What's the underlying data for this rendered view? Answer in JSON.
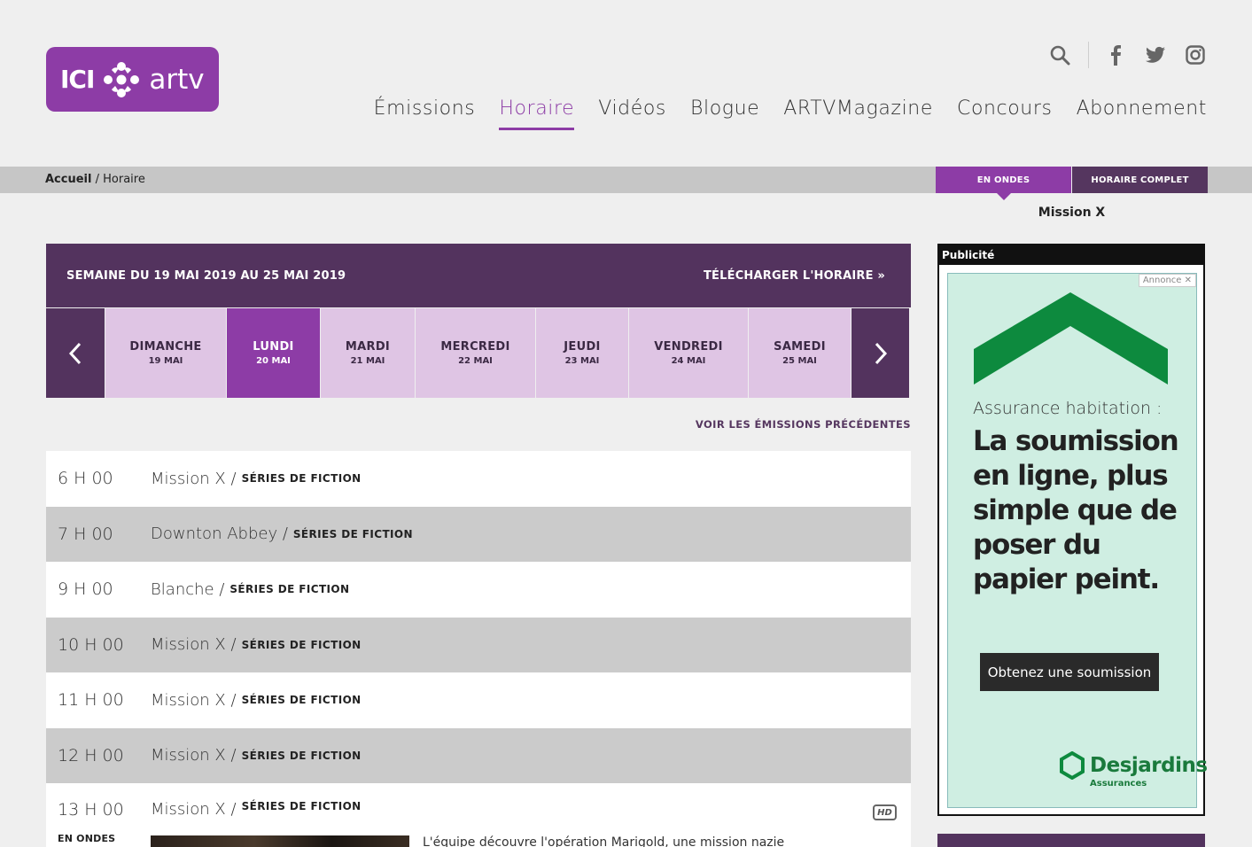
{
  "logo": {
    "ici": "ICI",
    "artv": "artv"
  },
  "nav": {
    "items": [
      "Émissions",
      "Horaire",
      "Vidéos",
      "Blogue",
      "ARTVMagazine",
      "Concours",
      "Abonnement"
    ],
    "active": "Horaire"
  },
  "icons": {
    "search": "search-icon",
    "facebook": "facebook-icon",
    "twitter": "twitter-icon",
    "instagram": "instagram-icon"
  },
  "breadcrumb": {
    "home": "Accueil",
    "current": "/ Horaire"
  },
  "onair": {
    "tab_onair": "EN ONDES",
    "tab_full": "HORAIRE COMPLET",
    "now_title": "Mission X"
  },
  "schedule": {
    "week_title": "SEMAINE DU 19 MAI 2019 AU 25 MAI 2019",
    "download": "TÉLÉCHARGER L'HORAIRE »",
    "days": [
      {
        "name": "DIMANCHE",
        "date": "19 MAI",
        "active": false
      },
      {
        "name": "LUNDI",
        "date": "20 MAI",
        "active": true
      },
      {
        "name": "MARDI",
        "date": "21 MAI",
        "active": false
      },
      {
        "name": "MERCREDI",
        "date": "22 MAI",
        "active": false
      },
      {
        "name": "JEUDI",
        "date": "23 MAI",
        "active": false
      },
      {
        "name": "VENDREDI",
        "date": "24 MAI",
        "active": false
      },
      {
        "name": "SAMEDI",
        "date": "25 MAI",
        "active": false
      }
    ],
    "prev_link": "VOIR LES ÉMISSIONS PRÉCÉDENTES",
    "programs": [
      {
        "time": "6 H 00",
        "title": "Mission X /",
        "category": "SÉRIES DE FICTION"
      },
      {
        "time": "7 H 00",
        "title": "Downton Abbey /",
        "category": "SÉRIES DE FICTION"
      },
      {
        "time": "9 H 00",
        "title": "Blanche /",
        "category": "SÉRIES DE FICTION"
      },
      {
        "time": "10 H 00",
        "title": "Mission X /",
        "category": "SÉRIES DE FICTION"
      },
      {
        "time": "11 H 00",
        "title": "Mission X /",
        "category": "SÉRIES DE FICTION"
      },
      {
        "time": "12 H 00",
        "title": "Mission X /",
        "category": "SÉRIES DE FICTION"
      }
    ],
    "current_program": {
      "time": "13 H 00",
      "title": "Mission X /",
      "category": "SÉRIES DE FICTION",
      "onair_label": "EN ONDES",
      "hd_badge": "HD",
      "description": "L'équipe découvre l'opération Marigold, une mission nazie"
    }
  },
  "ad": {
    "label": "Publicité",
    "annonce": "Annonce ✕",
    "kicker": "Assurance habitation :",
    "headline": "La soumission en ligne, plus simple que de poser du papier peint.",
    "cta": "Obtenez une soumission",
    "brand": "Desjardins",
    "brand_sub": "Assurances",
    "colors": {
      "green": "#0d8a3e",
      "bg": "#cfeee2"
    }
  },
  "colors": {
    "accent": "#8d3ca6",
    "dark_purple": "#53335e",
    "day_bg": "#dfc5e4"
  }
}
